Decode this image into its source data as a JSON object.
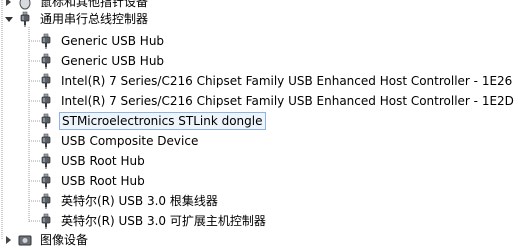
{
  "tree": {
    "prev_category": {
      "label": "鼠标和其他指针设备",
      "icon": "mouse-icon"
    },
    "usb_category": {
      "label": "通用串行总线控制器",
      "expanded": true,
      "icon": "usb-plug-icon",
      "children": [
        {
          "label": "Generic USB Hub",
          "icon": "usb-plug-icon"
        },
        {
          "label": "Generic USB Hub",
          "icon": "usb-plug-icon"
        },
        {
          "label": "Intel(R) 7 Series/C216 Chipset Family USB Enhanced Host Controller - 1E26",
          "icon": "usb-plug-icon"
        },
        {
          "label": "Intel(R) 7 Series/C216 Chipset Family USB Enhanced Host Controller - 1E2D",
          "icon": "usb-plug-icon"
        },
        {
          "label": "STMicroelectronics STLink dongle",
          "icon": "usb-plug-icon",
          "selected": true
        },
        {
          "label": "USB Composite Device",
          "icon": "usb-plug-icon"
        },
        {
          "label": "USB Root Hub",
          "icon": "usb-plug-icon"
        },
        {
          "label": "USB Root Hub",
          "icon": "usb-plug-icon"
        },
        {
          "label": "英特尔(R) USB 3.0 根集线器",
          "icon": "usb-plug-icon"
        },
        {
          "label": "英特尔(R) USB 3.0 可扩展主机控制器",
          "icon": "usb-plug-icon"
        }
      ]
    },
    "next_category": {
      "label": "图像设备",
      "icon": "camera-icon"
    }
  },
  "colors": {
    "selection_border": "#8fb4e0",
    "selection_fill": "#eef4fb",
    "tree_line": "#a0a0a0"
  }
}
